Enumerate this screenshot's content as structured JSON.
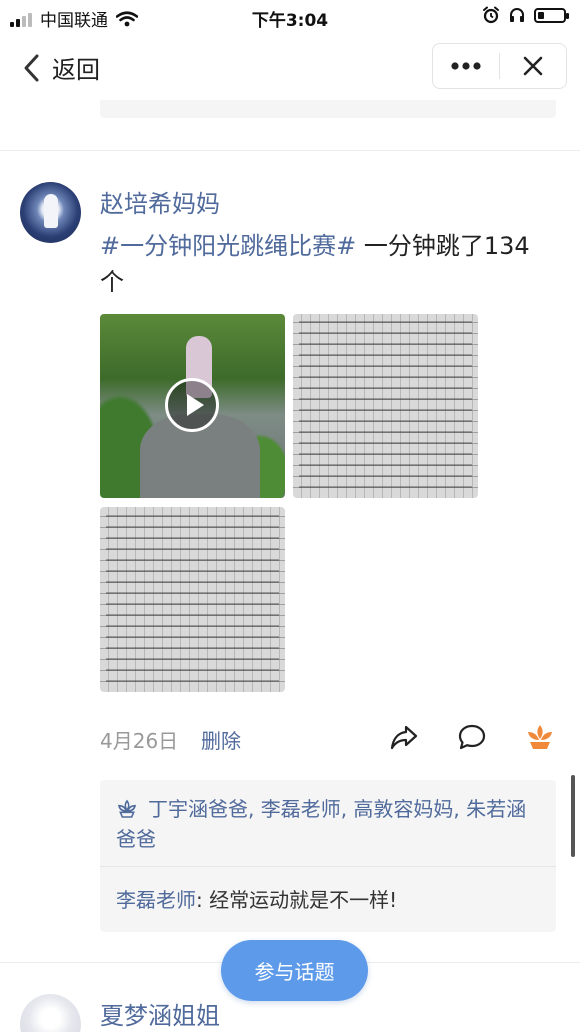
{
  "status_bar": {
    "carrier": "中国联通",
    "time": "下午3:04"
  },
  "nav": {
    "back_label": "返回",
    "more_icon": "more-dots-icon",
    "close_icon": "close-icon"
  },
  "post": {
    "author": "赵培希妈妈",
    "hashtag": "#一分钟阳光跳绳比赛#",
    "text": "一分钟跳了134个",
    "date": "4月26日",
    "delete_label": "删除",
    "likes_text": "丁宇涵爸爸, 李磊老师, 高敦容妈妈, 朱若涵爸爸",
    "comment": {
      "author": "李磊老师",
      "text": "经常运动就是不一样!"
    }
  },
  "next_post": {
    "author": "夏梦涵姐姐"
  },
  "join_button": "参与话题",
  "colors": {
    "link_blue": "#506a9c",
    "button_blue": "#5d9bea",
    "like_orange": "#f08a3a"
  }
}
